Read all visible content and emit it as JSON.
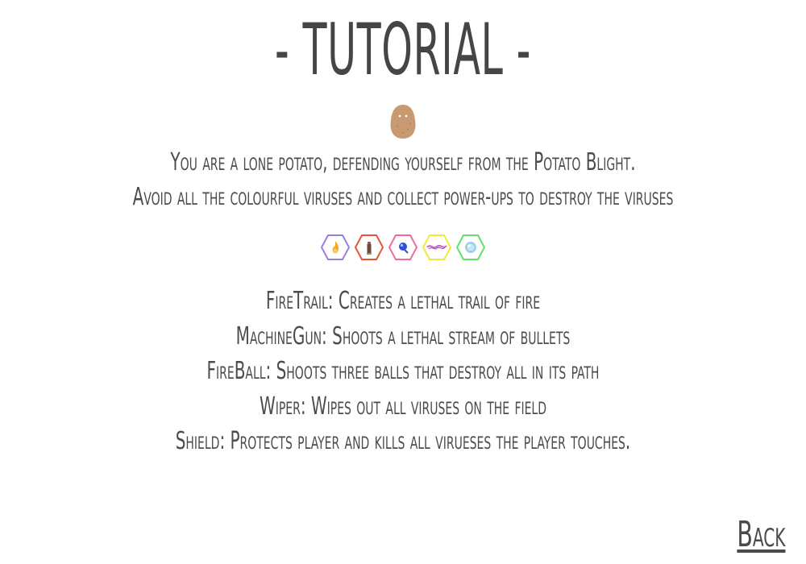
{
  "title": "- TUTORIAL -",
  "intro": {
    "line1": "You are a lone potato, defending yourself from the Potato Blight.",
    "line2": "Avoid all the colourful viruses and collect power-ups to destroy the viruses"
  },
  "powerup_icons": [
    {
      "name": "firetrail-icon",
      "border": "#9b7fe0",
      "accent": "#f5a623"
    },
    {
      "name": "machinegun-icon",
      "border": "#e8543a",
      "accent": "#8a5a44"
    },
    {
      "name": "fireball-icon",
      "border": "#f06aa0",
      "accent": "#2c4fd8"
    },
    {
      "name": "wiper-icon",
      "border": "#f2ea3a",
      "accent": "#d860c8"
    },
    {
      "name": "shield-icon",
      "border": "#63e06a",
      "accent": "#9ecfe8"
    }
  ],
  "descriptions": [
    "FireTrail: Creates a lethal trail of fire",
    "MachineGun: Shoots a lethal stream of bullets",
    "FireBall: Shoots three balls that destroy all in its path",
    "Wiper: Wipes out all viruses on the field",
    "Shield: Protects player and kills all virueses the player touches."
  ],
  "back_label": "Back",
  "colors": {
    "text": "#4a4a4a",
    "background": "#ffffff",
    "potato": "#c79a72"
  }
}
